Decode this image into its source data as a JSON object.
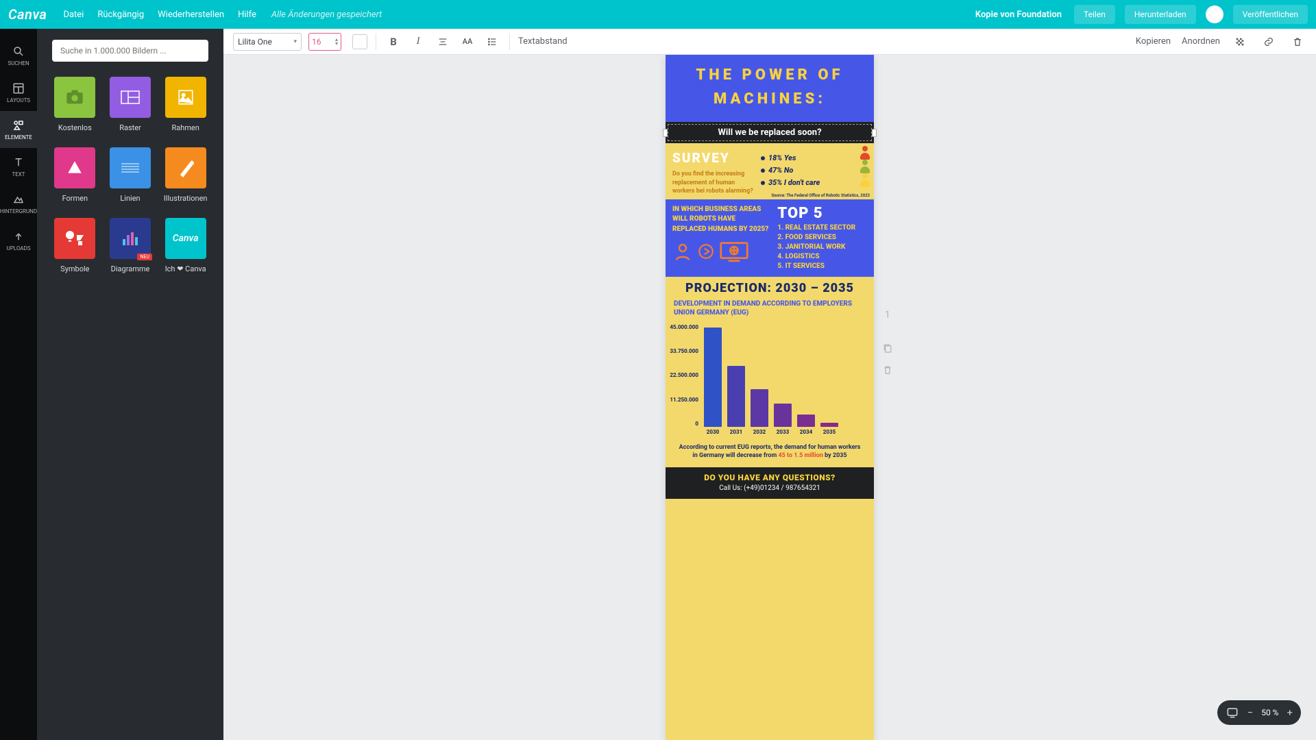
{
  "topbar": {
    "logo": "Canva",
    "menu": [
      "Datei",
      "Rückgängig",
      "Wiederherstellen",
      "Hilfe"
    ],
    "status": "Alle Änderungen gespeichert",
    "doc_title": "Kopie von Foundation",
    "share": "Teilen",
    "download": "Herunterladen",
    "publish": "Veröffentlichen"
  },
  "rail": {
    "items": [
      {
        "label": "SUCHEN",
        "icon": "search"
      },
      {
        "label": "LAYOUTS",
        "icon": "layouts"
      },
      {
        "label": "ELEMENTE",
        "icon": "elements",
        "active": true
      },
      {
        "label": "TEXT",
        "icon": "text"
      },
      {
        "label": "HINTERGRUND",
        "icon": "background"
      },
      {
        "label": "UPLOADS",
        "icon": "upload"
      }
    ]
  },
  "panel": {
    "search_placeholder": "Suche in 1.000.000 Bildern ...",
    "cats": [
      {
        "label": "Kostenlos",
        "tile": "green"
      },
      {
        "label": "Raster",
        "tile": "purple"
      },
      {
        "label": "Rahmen",
        "tile": "gold"
      },
      {
        "label": "Formen",
        "tile": "magenta"
      },
      {
        "label": "Linien",
        "tile": "blue"
      },
      {
        "label": "Illustrationen",
        "tile": "orange"
      },
      {
        "label": "Symbole",
        "tile": "red"
      },
      {
        "label": "Diagramme",
        "tile": "navy",
        "badge": "NEU"
      },
      {
        "label": "Ich ❤ Canva",
        "tile": "teal"
      }
    ]
  },
  "ctx": {
    "font": "Lilita One",
    "size": "16",
    "spacing": "Textabstand",
    "copy": "Kopieren",
    "arrange": "Anordnen"
  },
  "page_number": "1",
  "zoom": {
    "value": "50 %"
  },
  "infographic": {
    "title_l1": "THE POWER OF",
    "title_l2": "MACHINES:",
    "subtitle": "Will we be replaced soon?",
    "survey": {
      "title": "SURVEY",
      "question": "Do you find the increasing replacement of human workers bei robots alarming?",
      "items": [
        "18% Yes",
        "47% No",
        "35% I don't care"
      ],
      "source": "Source: The Federal Office of Robotic Statistics, 2023"
    },
    "areas": {
      "q_l1": "IN WHICH BUSINESS AREAS",
      "q_l2": "WILL ROBOTS HAVE",
      "q_l3": "REPLACED HUMANS BY 2025?",
      "top5": "TOP 5",
      "list": [
        "1. REAL ESTATE SECTOR",
        "2. FOOD SERVICES",
        "3. JANITORIAL WORK",
        "4. LOGISTICS",
        "5. IT SERVICES"
      ]
    },
    "projection": {
      "title": "PROJECTION: 2030 – 2035",
      "sub": "DEVELOPMENT IN DEMAND ACCORDING TO EMPLOYERS UNION GERMANY (EUG)"
    },
    "note_pre": "According to current EUG reports, the demand for human workers in Germany will decrease from ",
    "note_hl": "45 to 1.5 million",
    "note_post": " by 2035",
    "footer_q": "DO YOU HAVE ANY QUESTIONS?",
    "footer_c": "Call Us: (+49)01234 / 987654321"
  },
  "chart_data": {
    "type": "bar",
    "categories": [
      "2030",
      "2031",
      "2032",
      "2033",
      "2034",
      "2035"
    ],
    "values": [
      45000000,
      27500000,
      17000000,
      10500000,
      5500000,
      1900000
    ],
    "colors": [
      "#2f52c7",
      "#4a3fb0",
      "#5b38a5",
      "#6a339b",
      "#7a2e91",
      "#8a2987"
    ],
    "y_ticks": [
      "45.000.000",
      "33.750.000",
      "22.500.000",
      "11.250.000",
      "0"
    ],
    "ylim": [
      0,
      45000000
    ],
    "title": "",
    "xlabel": "",
    "ylabel": ""
  }
}
